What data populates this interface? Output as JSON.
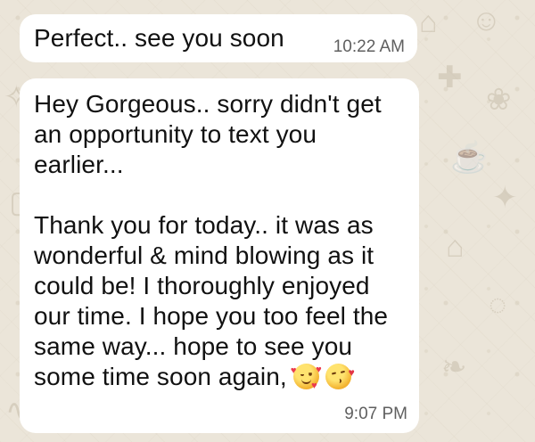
{
  "conversation": {
    "messages": [
      {
        "text": "Perfect.. see you soon",
        "time": "10:22 AM"
      },
      {
        "lines": [
          "Hey Gorgeous.. sorry didn't get",
          "an opportunity to text you",
          "earlier...",
          "Thank you for today.. it was as",
          "wonderful & mind blowing as it",
          "could be! I thoroughly enjoyed",
          "our time. I hope you too feel the",
          "same way... hope to see you",
          "some time soon again,"
        ],
        "emojis": [
          "smiling-face-with-hearts",
          "face-blowing-a-kiss"
        ],
        "time": "9:07 PM"
      }
    ]
  }
}
